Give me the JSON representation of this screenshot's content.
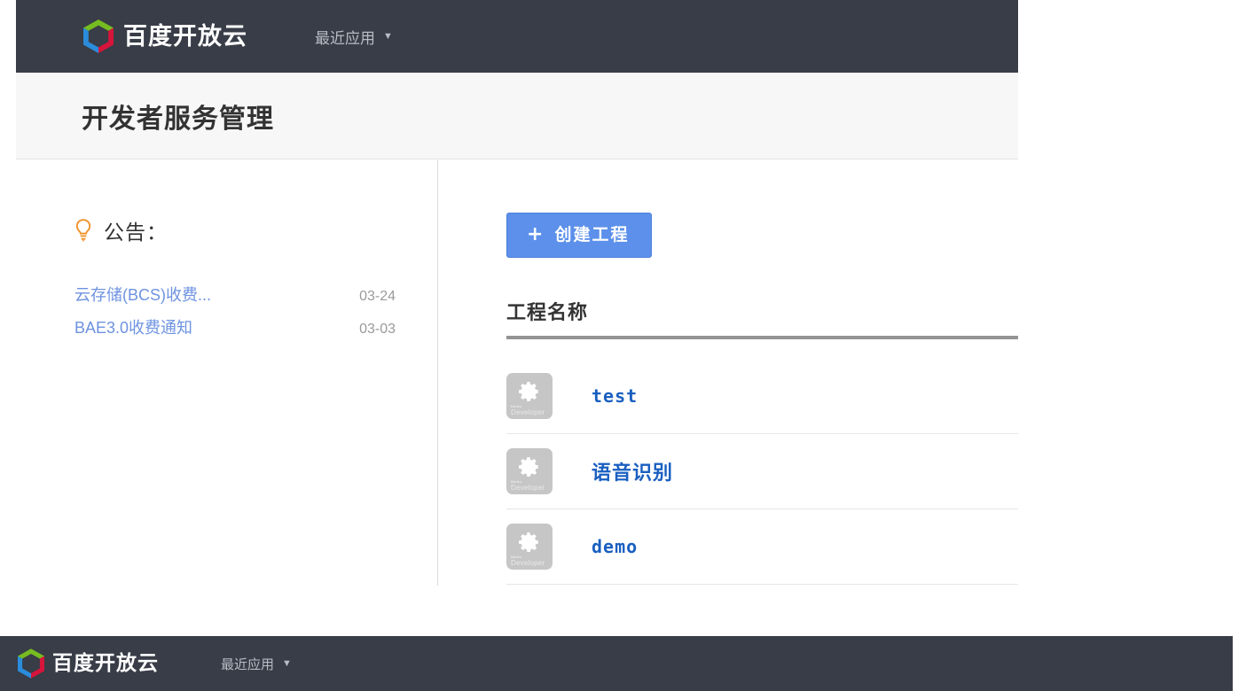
{
  "brand": {
    "name": "百度开放云",
    "logo_icon": "baidu-cloud-hexagon-logo",
    "logo_colors": {
      "green": "#76bc21",
      "blue": "#2b8cdb",
      "red": "#d6143c",
      "dark": "#383d47"
    }
  },
  "navbar": {
    "menu_label": "最近应用",
    "caret_icon": "chevron-down-icon",
    "background": "#383d47",
    "text_color": "#b8bcc4"
  },
  "page": {
    "title": "开发者服务管理",
    "title_band_bg": "#f7f7f7"
  },
  "sidebar": {
    "notice_icon": "lightbulb-icon",
    "notice_icon_color": "#f0922b",
    "notice_heading": "公告：",
    "notices": [
      {
        "title": "云存储(BCS)收费...",
        "date": "03-24"
      },
      {
        "title": "BAE3.0收费通知",
        "date": "03-03"
      }
    ],
    "link_color": "#6e93e0",
    "date_color": "#9a9a9a"
  },
  "main": {
    "create_button": {
      "label": "创建工程",
      "plus_icon": "plus-icon",
      "color": "#5c90ea"
    },
    "table": {
      "column_header": "工程名称",
      "rule_color": "#949494",
      "rows": [
        {
          "name": "test",
          "icon": "gear-icon",
          "icon_sub_top": "Baidu",
          "icon_sub_main": "Developer",
          "script": "latin"
        },
        {
          "name": "语音识别",
          "icon": "gear-icon",
          "icon_sub_top": "Baidu",
          "icon_sub_main": "Developer",
          "script": "cjk"
        },
        {
          "name": "demo",
          "icon": "gear-icon",
          "icon_sub_top": "Baidu",
          "icon_sub_main": "Developer",
          "script": "latin"
        }
      ],
      "row_link_color": "#1a5fc0"
    }
  },
  "bottom_window": {
    "brand_name": "百度开放云",
    "menu_label": "最近应用",
    "caret_icon": "chevron-down-icon"
  }
}
